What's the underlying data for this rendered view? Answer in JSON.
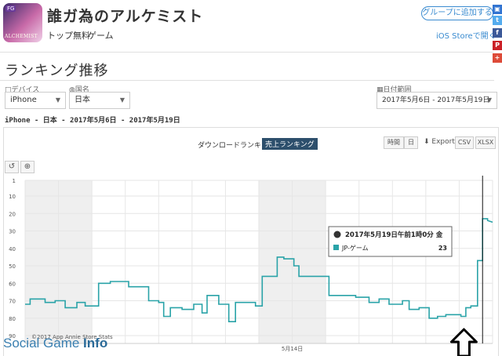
{
  "app": {
    "name": "誰ガ為のアルケミスト",
    "category": "トップ無料",
    "genre": "ゲーム",
    "icon_badge": "FG",
    "icon_logo": "ALCHEMIST",
    "group_button": "グループに追加する",
    "ios_link": "iOS Storeで開く"
  },
  "social": [
    {
      "name": "delicious",
      "color": "#3274d1",
      "glyph": "▣"
    },
    {
      "name": "twitter",
      "color": "#55acee",
      "glyph": "t"
    },
    {
      "name": "facebook",
      "color": "#3b5998",
      "glyph": "f"
    },
    {
      "name": "pinterest",
      "color": "#cb2027",
      "glyph": "P"
    },
    {
      "name": "googleplus",
      "color": "#dd4b39",
      "glyph": "+"
    }
  ],
  "page_title": "ランキング推移",
  "filters": {
    "device_label": "デバイス",
    "device_value": "iPhone",
    "country_label": "国名",
    "country_value": "日本",
    "date_label": "日付範囲",
    "date_value": "2017年5月6日 - 2017年5月19日"
  },
  "summary": "iPhone - 日本 - 2017年5月6日 - 2017年5月19日",
  "tabs": {
    "downloads": "ダウンロードランキング",
    "revenue": "売上ランキング"
  },
  "toolbar": {
    "time": "時間",
    "day": "日",
    "export": "Export",
    "csv": "CSV",
    "xlsx": "XLSX"
  },
  "tooltip": {
    "title": "2017年5月19日午前1時0分 金",
    "series": "JP-ゲーム",
    "value": "23"
  },
  "copyright": "©2017 App Annie Store Stats",
  "watermark": {
    "a": "Social Game",
    "b": " Info"
  },
  "colors": {
    "series": "#2aa3a8",
    "link": "#3a8bd0",
    "active_tab": "#2d4f6c"
  },
  "chart_data": {
    "type": "line",
    "series": [
      {
        "name": "JP-ゲーム"
      }
    ],
    "y_reversed": true,
    "y_ticks": [
      "1",
      "10",
      "20",
      "30",
      "40",
      "50",
      "60",
      "70",
      "80",
      "90"
    ],
    "ylim": [
      1,
      90
    ],
    "x_labels": [
      {
        "label": "5月14日",
        "day": 8
      }
    ],
    "weekend_days": [
      [
        0,
        2
      ],
      [
        7,
        9
      ]
    ],
    "x_range": [
      0,
      14
    ],
    "points": [
      [
        0.0,
        72
      ],
      [
        0.15,
        72
      ],
      [
        0.15,
        69
      ],
      [
        0.6,
        69
      ],
      [
        0.6,
        71
      ],
      [
        0.9,
        71
      ],
      [
        0.9,
        70
      ],
      [
        1.2,
        70
      ],
      [
        1.2,
        74
      ],
      [
        1.55,
        74
      ],
      [
        1.55,
        71
      ],
      [
        1.8,
        71
      ],
      [
        1.8,
        73
      ],
      [
        2.2,
        73
      ],
      [
        2.2,
        60
      ],
      [
        2.55,
        60
      ],
      [
        2.55,
        59
      ],
      [
        3.1,
        59
      ],
      [
        3.1,
        62
      ],
      [
        3.7,
        62
      ],
      [
        3.7,
        70
      ],
      [
        4.0,
        70
      ],
      [
        4.0,
        71
      ],
      [
        4.15,
        71
      ],
      [
        4.15,
        79
      ],
      [
        4.35,
        79
      ],
      [
        4.35,
        74
      ],
      [
        4.7,
        74
      ],
      [
        4.7,
        75
      ],
      [
        5.05,
        75
      ],
      [
        5.05,
        72
      ],
      [
        5.3,
        72
      ],
      [
        5.3,
        77
      ],
      [
        5.45,
        77
      ],
      [
        5.45,
        67
      ],
      [
        5.8,
        67
      ],
      [
        5.8,
        72
      ],
      [
        6.1,
        72
      ],
      [
        6.1,
        82
      ],
      [
        6.3,
        82
      ],
      [
        6.3,
        71
      ],
      [
        6.9,
        71
      ],
      [
        6.9,
        73
      ],
      [
        7.1,
        73
      ],
      [
        7.1,
        56
      ],
      [
        7.55,
        56
      ],
      [
        7.55,
        45
      ],
      [
        7.75,
        45
      ],
      [
        7.75,
        46
      ],
      [
        8.05,
        46
      ],
      [
        8.05,
        50
      ],
      [
        8.2,
        50
      ],
      [
        8.2,
        56
      ],
      [
        9.1,
        56
      ],
      [
        9.1,
        67
      ],
      [
        9.9,
        67
      ],
      [
        9.9,
        68
      ],
      [
        10.3,
        68
      ],
      [
        10.3,
        71
      ],
      [
        10.6,
        71
      ],
      [
        10.6,
        69
      ],
      [
        10.9,
        69
      ],
      [
        10.9,
        72
      ],
      [
        11.3,
        72
      ],
      [
        11.3,
        70
      ],
      [
        11.5,
        70
      ],
      [
        11.5,
        75
      ],
      [
        11.8,
        75
      ],
      [
        11.8,
        74
      ],
      [
        12.1,
        74
      ],
      [
        12.1,
        80
      ],
      [
        12.35,
        80
      ],
      [
        12.35,
        79
      ],
      [
        12.6,
        79
      ],
      [
        12.6,
        78
      ],
      [
        13.05,
        78
      ],
      [
        13.05,
        79
      ],
      [
        13.2,
        79
      ],
      [
        13.2,
        74
      ],
      [
        13.35,
        74
      ],
      [
        13.35,
        73
      ],
      [
        13.55,
        73
      ],
      [
        13.55,
        47
      ],
      [
        13.7,
        47
      ],
      [
        13.7,
        23
      ],
      [
        13.85,
        23
      ],
      [
        13.85,
        24
      ],
      [
        14.0,
        25
      ]
    ],
    "crosshair_x": 13.7,
    "arrow_x": 13.0
  }
}
